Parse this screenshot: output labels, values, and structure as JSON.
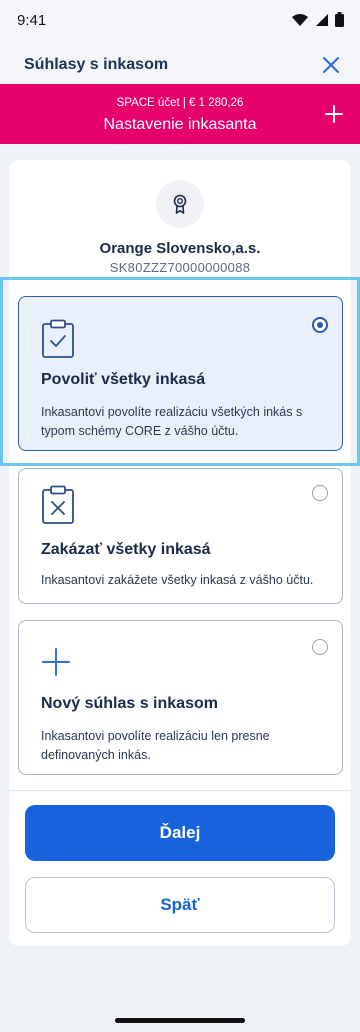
{
  "status_bar": {
    "time": "9:41"
  },
  "header": {
    "title": "Súhlasy s inkasom"
  },
  "banner": {
    "subtitle": "SPACE účet | € 1 280,26",
    "title": "Nastavenie inkasanta"
  },
  "payee": {
    "name": "Orange Slovensko,a.s.",
    "id": "SK80ZZZ70000000088"
  },
  "options": [
    {
      "title": "Povoliť všetky inkasá",
      "description": "Inkasantovi povolíte realizáciu všetkých inkás s typom schémy CORE z vášho účtu.",
      "selected": true,
      "icon": "clipboard-check-icon"
    },
    {
      "title": "Zakázať všetky inkasá",
      "description": "Inkasantovi zakážete všetky inkasá z vášho účtu.",
      "selected": false,
      "icon": "clipboard-x-icon"
    },
    {
      "title": "Nový súhlas s inkasom",
      "description": "Inkasantovi povolíte realizáciu len presne definovaných inkás.",
      "selected": false,
      "icon": "plus-icon"
    }
  ],
  "buttons": {
    "next": "Ďalej",
    "back": "Späť"
  },
  "colors": {
    "brand": "#e5006b",
    "primary": "#1763de",
    "selected_bg": "#eaf0fb",
    "highlight": "#6cc6f0"
  }
}
